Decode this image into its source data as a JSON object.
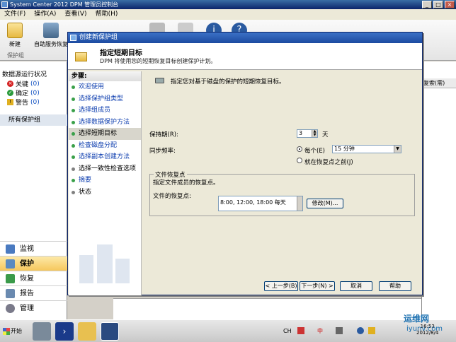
{
  "window": {
    "title": "System Center 2012 DPM 管理员控制台"
  },
  "menu": [
    "文件(F)",
    "操作(A)",
    "查看(V)",
    "帮助(H)"
  ],
  "toolbar": {
    "new_label": "新建",
    "self_service_label": "自助服务恢复",
    "group_label": "保护组"
  },
  "nav": {
    "status_title": "数据源运行状况",
    "critical_label": "关键",
    "critical_count": "(0)",
    "warning_label": "确定",
    "warning_count": "(0)",
    "alert_label": "警告",
    "alert_count": "(0)",
    "all_groups": "所有保护组",
    "workspaces": [
      "监视",
      "保护",
      "恢复",
      "报告",
      "管理"
    ],
    "selected": "保护"
  },
  "background": {
    "column_header": "复索(需)"
  },
  "dialog": {
    "title": "创建新保护组",
    "heading": "指定短期目标",
    "subheading": "DPM 将使用您的短期恢复目标创建保护计划。",
    "steps_title": "步骤:",
    "steps": [
      "欢迎使用",
      "选择保护组类型",
      "选择组成员",
      "选择数据保护方法",
      "选择短期目标",
      "检查磁盘分配",
      "选择副本创建方法",
      "选择一致性检查选项",
      "摘要",
      "状态"
    ],
    "current_step": 4,
    "description": "指定您对基于磁盘的保护的短期恢复目标。",
    "retention_label": "保持期(R):",
    "retention_value": "3",
    "retention_unit": "天",
    "sync_label": "同步频率:",
    "every_label": "每个(E)",
    "every_value": "15 分钟",
    "before_rp_label": "就在恢复点之前(J)",
    "group_title": "文件恢复点",
    "group_desc": "指定文件成员的恢复点。",
    "file_rp_label": "文件的恢复点:",
    "file_rp_value": "8:00, 12:00, 18:00 每天",
    "modify_label": "修改(M)...",
    "back_label": "< 上一步(B)",
    "next_label": "下一步(N) >",
    "cancel_label": "取消",
    "help_label": "帮助"
  },
  "taskbar": {
    "start_label": "开始",
    "lang": "CH",
    "ime": "中",
    "time": "16:53",
    "date": "2012/8/4"
  },
  "watermark": {
    "text": "运维网",
    "url": "iyunv.com"
  }
}
